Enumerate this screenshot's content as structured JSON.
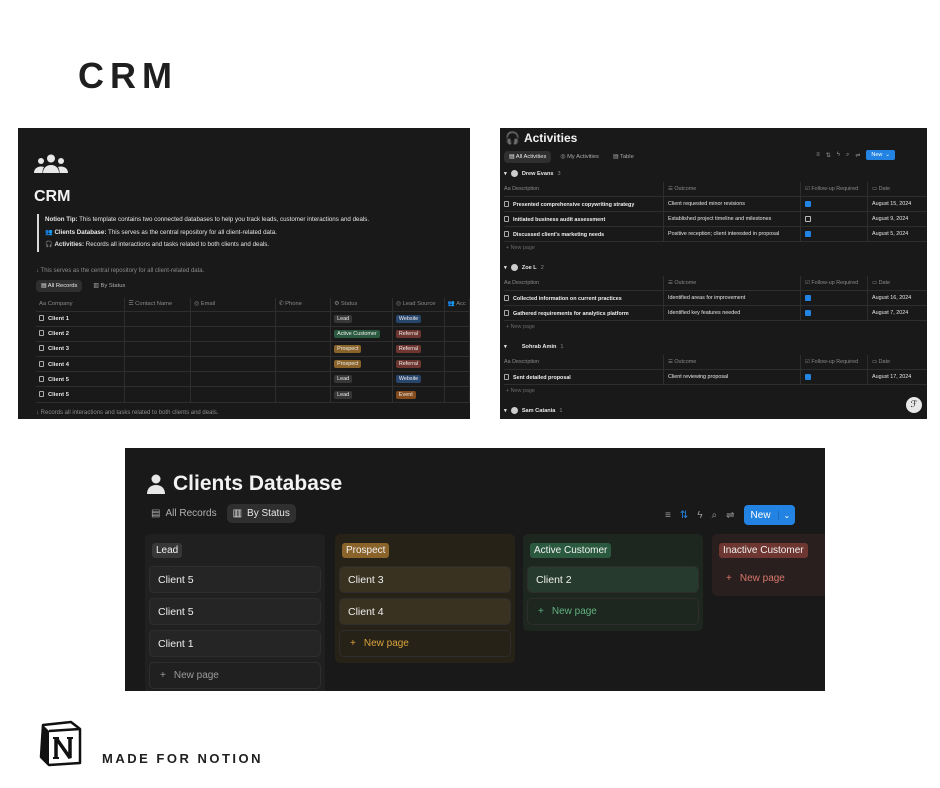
{
  "hero_title": "CRM",
  "footer_text": "MADE FOR NOTION",
  "crm": {
    "title": "CRM",
    "tip_title": "Notion Tip:",
    "tip_text": "This template contains two connected databases to help you track leads, customer interactions and deals.",
    "clients_label": "Clients Database:",
    "clients_text": "This serves as the central repository for all client-related data.",
    "activities_label": "Activities:",
    "activities_text": "Records all interactions and tasks related to both clients and deals.",
    "note_top": "↓ This serves as the central repository for all client-related data.",
    "note_bottom": "↓ Records all interactions and tasks related to both clients and deals.",
    "tabs": [
      "All Records",
      "By Status"
    ],
    "columns": [
      "Aa Company",
      "☰ Contact Name",
      "◎ Email",
      "✆ Phone",
      "⚙ Status",
      "◎ Lead Source",
      "👥 Acc"
    ],
    "rows": [
      {
        "company": "Client 1",
        "status": "Lead",
        "source": "Website"
      },
      {
        "company": "Client 2",
        "status": "Active Customer",
        "source": "Referral"
      },
      {
        "company": "Client 3",
        "status": "Prospect",
        "source": "Referral"
      },
      {
        "company": "Client 4",
        "status": "Prospect",
        "source": "Referral"
      },
      {
        "company": "Client 5",
        "status": "Lead",
        "source": "Website"
      },
      {
        "company": "Client 5",
        "status": "Lead",
        "source": "Event"
      }
    ]
  },
  "activities": {
    "title": "Activities",
    "tabs": [
      "All Activities",
      "My Activities",
      "Table"
    ],
    "new_label": "New",
    "columns": [
      "Aa Description",
      "☰ Outcome",
      "☑ Follow-up Required",
      "▭ Date"
    ],
    "new_page": "+ New page",
    "groups": [
      {
        "name": "Drew Evans",
        "count": "3",
        "rows": [
          {
            "desc": "Presented comprehensive copywriting strategy",
            "outcome": "Client requested minor revisions",
            "check": true,
            "date": "August 15, 2024"
          },
          {
            "desc": "Initiated business audit assessment",
            "outcome": "Established project timeline and milestones",
            "check": false,
            "date": "August 9, 2024"
          },
          {
            "desc": "Discussed client's marketing needs",
            "outcome": "Positive reception; client interested in proposal",
            "check": true,
            "date": "August 5, 2024"
          }
        ]
      },
      {
        "name": "Zoe L",
        "count": "2",
        "rows": [
          {
            "desc": "Collected information on current practices",
            "outcome": "Identified areas for improvement",
            "check": true,
            "date": "August 16, 2024"
          },
          {
            "desc": "Gathered requirements for analytics platform",
            "outcome": "Identified key features needed",
            "check": true,
            "date": "August 7, 2024"
          }
        ]
      },
      {
        "name": "Sohrab Amin",
        "count": "1",
        "rows": [
          {
            "desc": "Sent detailed proposal",
            "outcome": "Client reviewing proposal",
            "check": true,
            "date": "August 17, 2024"
          }
        ]
      },
      {
        "name": "Sam Catania",
        "count": "1",
        "rows": []
      }
    ]
  },
  "clients": {
    "title": "Clients Database",
    "tabs": [
      "All Records",
      "By Status"
    ],
    "new_label": "New",
    "new_page": "New page",
    "columns": [
      {
        "name": "Lead",
        "cards": [
          "Client 5",
          "Client 5",
          "Client 1"
        ]
      },
      {
        "name": "Prospect",
        "cards": [
          "Client 3",
          "Client 4"
        ]
      },
      {
        "name": "Active Customer",
        "cards": [
          "Client 2"
        ]
      },
      {
        "name": "Inactive Customer",
        "cards": []
      }
    ]
  },
  "colors": {
    "lead": "#373737",
    "prospect": "#89632a",
    "active": "#2b593f",
    "inactive": "#6e3630",
    "website": "#28456c",
    "referral": "#6e3630",
    "event": "#854c1d",
    "accent": "#2383e2"
  }
}
